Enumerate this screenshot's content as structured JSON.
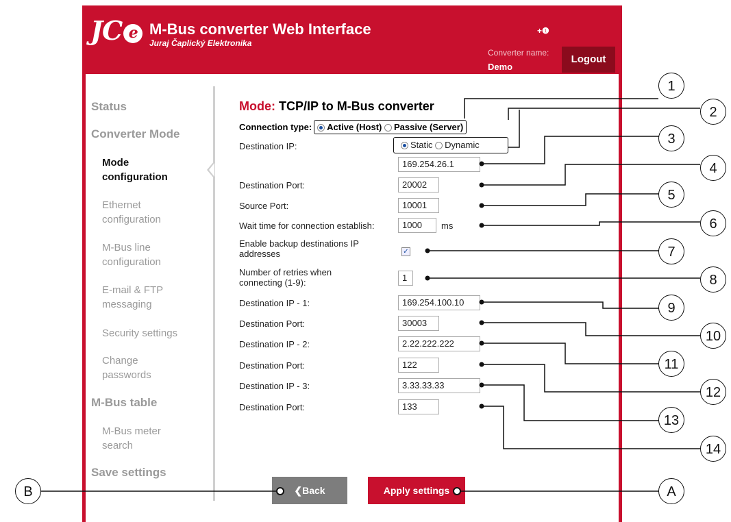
{
  "header": {
    "logo_text": "JC",
    "logo_e": "e",
    "title": "M-Bus converter Web Interface",
    "subtitle": "Juraj Čaplický Elektronika",
    "info_icon": "+❶",
    "converter_name_label": "Converter name:",
    "converter_name_value": "Demo",
    "logout_label": "Logout"
  },
  "sidebar": {
    "status": "Status",
    "converter_mode": "Converter Mode",
    "mode_configuration": "Mode configuration",
    "ethernet_configuration": "Ethernet configuration",
    "mbus_line_configuration": "M-Bus line configuration",
    "email_ftp": "E-mail & FTP messaging",
    "security_settings": "Security settings",
    "change_passwords": "Change passwords",
    "mbus_table": "M-Bus table",
    "mbus_meter_search": "M-Bus meter search",
    "save_settings": "Save settings"
  },
  "main": {
    "mode_label": "Mode:",
    "mode_value": "TCP/IP to M-Bus converter",
    "connection_type_label": "Connection type:",
    "active_option": "Active (Host)",
    "passive_option": "Passive (Server)",
    "destination_ip_label": "Destination IP:",
    "static_option": "Static",
    "dynamic_option": "Dynamic",
    "destination_ip_value": "169.254.26.1",
    "destination_port_label": "Destination Port:",
    "destination_port_value": "20002",
    "source_port_label": "Source Port:",
    "source_port_value": "10001",
    "wait_time_label": "Wait time for connection establish:",
    "wait_time_value": "1000",
    "wait_time_unit": "ms",
    "backup_label": "Enable backup destinations IP addresses",
    "backup_checked": "✓",
    "retries_label": "Number of retries when connecting (1-9):",
    "retries_value": "1",
    "dest_ip_1_label": "Destination IP - 1:",
    "dest_ip_1_value": "169.254.100.10",
    "dest_port_1_label": "Destination Port:",
    "dest_port_1_value": "30003",
    "dest_ip_2_label": "Destination IP - 2:",
    "dest_ip_2_value": "2.22.222.222",
    "dest_port_2_label": "Destination Port:",
    "dest_port_2_value": "122",
    "dest_ip_3_label": "Destination IP - 3:",
    "dest_ip_3_value": "3.33.33.33",
    "dest_port_3_label": "Destination Port:",
    "dest_port_3_value": "133"
  },
  "buttons": {
    "back_label": "❮Back",
    "apply_label": "Apply settings"
  },
  "callouts": [
    "1",
    "2",
    "3",
    "4",
    "5",
    "6",
    "7",
    "8",
    "9",
    "10",
    "11",
    "12",
    "13",
    "14",
    "A",
    "B"
  ],
  "colors": {
    "brand": "#c8102e",
    "dark_brand": "#8b0b1d",
    "back_button": "#7d7d7d"
  }
}
